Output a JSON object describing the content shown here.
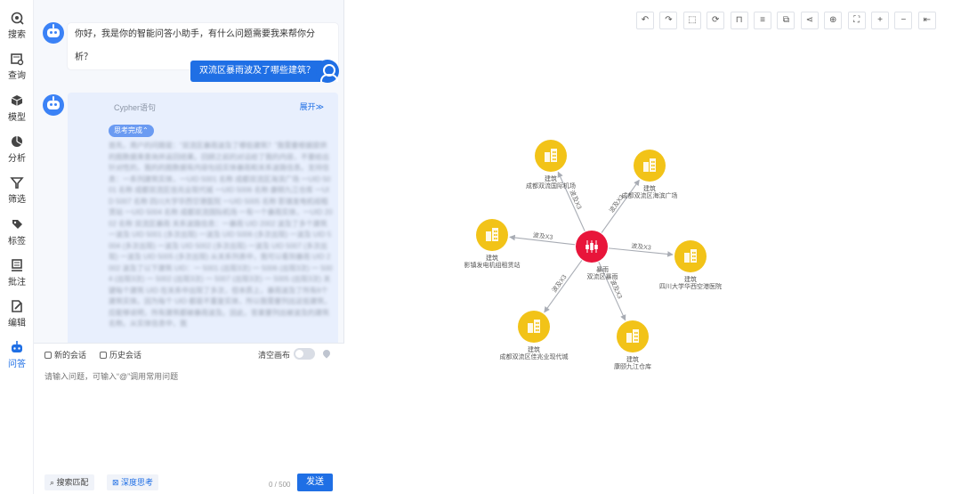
{
  "rail": [
    {
      "label": "搜索",
      "icon": "search-icon"
    },
    {
      "label": "查询",
      "icon": "query-icon"
    },
    {
      "label": "模型",
      "icon": "cube-icon"
    },
    {
      "label": "分析",
      "icon": "pie-chart-icon"
    },
    {
      "label": "筛选",
      "icon": "filter-icon"
    },
    {
      "label": "标签",
      "icon": "tag-icon"
    },
    {
      "label": "批注",
      "icon": "annotation-icon"
    },
    {
      "label": "编辑",
      "icon": "edit-icon"
    },
    {
      "label": "问答",
      "icon": "robot-icon",
      "active": true
    }
  ],
  "chat": {
    "greeting": "你好，我是你的智能问答小助手，有什么问题需要我来帮你分析？",
    "user_question": "双流区暴雨波及了哪些建筑？",
    "answer": {
      "cypher_title": "Cypher语句",
      "expand_label": "展开≫",
      "thinking_label": "思考完成⌃",
      "thinking_text": "首先，用户的问题是：“双流区暴雨波及了哪些建筑？”我需要根据提供的图数据来查询并返回结果。回顾之前的对话给了我的内容，不要给出针对性的，我的的图数据有内容包括实体暴雨和关系波路信息。支持信息：一系列建筑实体，一UID 5001 名称 成都双流区海滨广场 一UID 5001 名称 成都双流区佳兆业现代城 一UID 5006 名称 康颐九江仓库 一UID 5007 名称 四川大学华西空港医院 一UID 5005 名称 影镇发电机组租赁站 一UID 5004 名称 成都双流国际机场 一有一个暴雨实体，一UID 2002 名称 双流区暴雨 关系波路信息：一暴雨 UID 2002 波及了多个建筑 一波及 UID 5001 (多次出现) 一波及 UID 5006 (多次出现) 一波及 UID 5004 (多次出现) 一波及 UID 5002 (多次出现) 一波及 UID 5007 (多次出现) 一波及 UID 5005 (多次出现) 从关系列表中，我可以看到暴雨 UID 2002 波及了以下建筑 UID：一 5001 (出现3次) 一 5006 (出现3次) 一 5004 (出现3次) 一 5002 (出现3次) 一 5007 (出现3次) 一 5005 (出现3次) 关键每个建筑 UID 在关系中出现了多次，但本质上，暴雨波及了所有6个建筑实体。因为每个 UID 都是不重复实体，所以我需要列出这些建筑，应能够说明，所有建筑都被暴雨波及。因此，答案要列出被波及的建筑名称。从实体信息中，我"
    }
  },
  "composer": {
    "new_chat": "新的会话",
    "history": "历史会话",
    "clear_canvas": "清空画布",
    "placeholder": "请输入问题，可输入“@”调用常用问题",
    "search_match": "搜索匹配",
    "deep_think": "深度思考",
    "counter": "0 / 500",
    "send": "发送"
  },
  "toolbar": [
    {
      "icon": "undo-icon",
      "glyph": "↶"
    },
    {
      "icon": "redo-icon",
      "glyph": "↷"
    },
    {
      "icon": "box-select-icon",
      "glyph": "⬚"
    },
    {
      "icon": "refresh-icon",
      "glyph": "⟳"
    },
    {
      "icon": "hierarchy-layout-icon",
      "glyph": "⊓"
    },
    {
      "icon": "align-icon",
      "glyph": "≡"
    },
    {
      "icon": "cluster-icon",
      "glyph": "⧉"
    },
    {
      "icon": "share-graph-icon",
      "glyph": "⋖"
    },
    {
      "icon": "locate-icon",
      "glyph": "⊕"
    },
    {
      "icon": "fullscreen-icon",
      "glyph": "⛶"
    },
    {
      "icon": "zoom-in-icon",
      "glyph": "+"
    },
    {
      "icon": "zoom-out-icon",
      "glyph": "−"
    },
    {
      "icon": "collapse-panel-icon",
      "glyph": "⇤"
    }
  ],
  "graph": {
    "center": {
      "type": "暴雨",
      "name": "双流区暴雨",
      "color": "#e8153a"
    },
    "building_color": "#f2c318",
    "edge_label": "波及X3",
    "nodes": [
      {
        "type": "建筑",
        "name": "成都双流国际机场"
      },
      {
        "type": "建筑",
        "name": "成都双流区海滨广场"
      },
      {
        "type": "建筑",
        "name": "影镇发电机组租赁站"
      },
      {
        "type": "建筑",
        "name": "四川大学华西空港医院"
      },
      {
        "type": "建筑",
        "name": "成都双流区佳兆业现代城"
      },
      {
        "type": "建筑",
        "name": "康颐九江仓库"
      }
    ]
  }
}
